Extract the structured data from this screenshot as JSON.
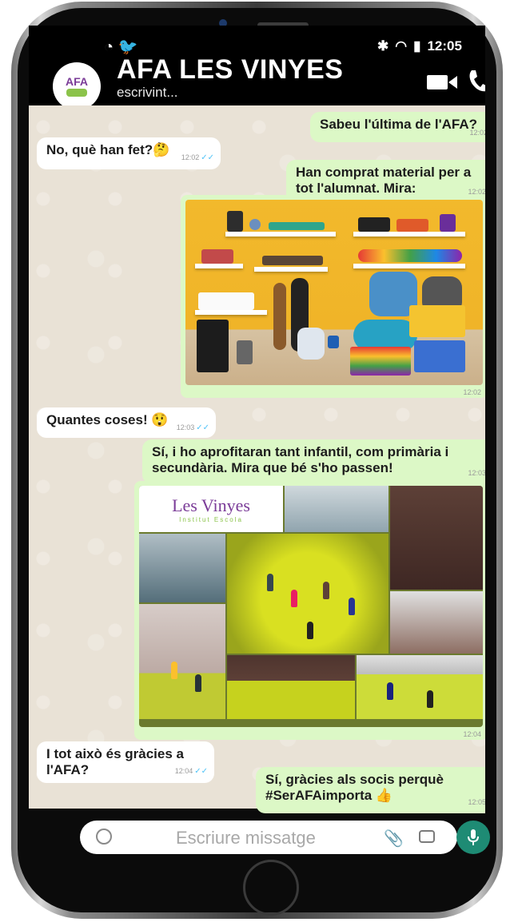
{
  "header": {
    "avatar_text": "AFA",
    "title": "AFA LES VINYES",
    "subtitle": "escrivint...",
    "status_time": "12:05"
  },
  "messages": [
    {
      "side": "out",
      "text": "Sabeu l'última de l'AFA?",
      "time": "12:02"
    },
    {
      "side": "in",
      "text": "No, què han fet?🤔",
      "time": "12:02"
    },
    {
      "side": "out",
      "text": "Han comprat material per a tot l'alumnat. Mira:",
      "time": "12:02"
    },
    {
      "side": "out",
      "type": "image",
      "time": "12:02"
    },
    {
      "side": "in",
      "text": "Quantes coses! 😲",
      "time": "12:03"
    },
    {
      "side": "out",
      "text": "Sí, i ho aprofitaran tant infantil, com primària i secundària. Mira que bé s'ho passen!",
      "time": "12:03"
    },
    {
      "side": "out",
      "type": "image",
      "time": "12:04",
      "logo_title": "Les Vinyes",
      "logo_subtitle": "Institut Escola"
    },
    {
      "side": "in",
      "text": "I tot això és gràcies a l'AFA?",
      "time": "12:04"
    },
    {
      "side": "out",
      "text": "Sí, gràcies als socis perquè #SerAFAimporta 👍",
      "time": "12:05"
    }
  ],
  "input": {
    "placeholder": "Escriure missatge"
  },
  "colors": {
    "outgoing": "#dcf8c6",
    "incoming": "#ffffff",
    "mic": "#1e8b74"
  }
}
